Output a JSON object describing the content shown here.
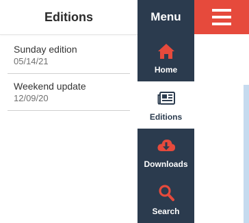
{
  "editions": {
    "title": "Editions",
    "items": [
      {
        "title": "Sunday edition",
        "date": "05/14/21"
      },
      {
        "title": "Weekend update",
        "date": "12/09/20"
      }
    ]
  },
  "menu": {
    "title": "Menu",
    "items": [
      {
        "label": "Home",
        "icon": "home-icon"
      },
      {
        "label": "Editions",
        "icon": "newspaper-icon",
        "active": true
      },
      {
        "label": "Downloads",
        "icon": "cloud-download-icon"
      },
      {
        "label": "Search",
        "icon": "search-icon"
      }
    ]
  },
  "hamburger": {
    "icon": "hamburger-menu-icon"
  },
  "colors": {
    "menu_bg": "#2b3b4e",
    "accent": "#e64a3c",
    "content_blue": "#c6dbef"
  }
}
